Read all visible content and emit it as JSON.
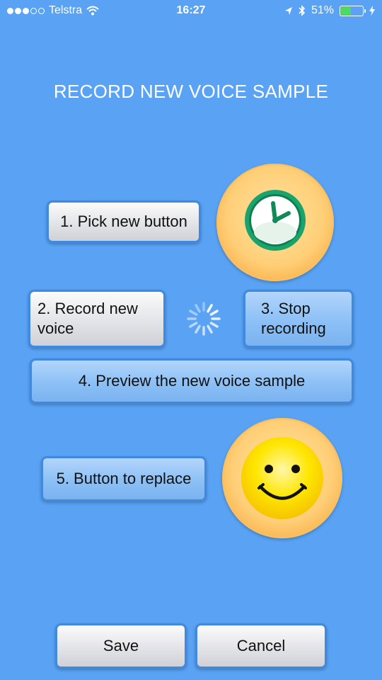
{
  "status_bar": {
    "carrier": "Telstra",
    "time": "16:27",
    "battery_percent": "51%",
    "battery_level": 0.51,
    "signal_bars_filled": 3,
    "signal_bars_total": 5,
    "icons": [
      "wifi-icon",
      "location-arrow-icon",
      "bluetooth-icon",
      "battery-icon",
      "charging-bolt-icon"
    ]
  },
  "page": {
    "title": "RECORD NEW VOICE SAMPLE"
  },
  "steps": {
    "pick_label": "1. Pick new button",
    "record_label": "2. Record new voice",
    "stop_label": "3. Stop recording",
    "preview_label": "4. Preview the new voice sample",
    "replace_label": "5. Button to replace"
  },
  "images": {
    "new_button_icon": "clock-icon",
    "replace_button_icon": "smiley-face-icon",
    "activity": "spinner-icon"
  },
  "footer": {
    "save_label": "Save",
    "cancel_label": "Cancel"
  },
  "colors": {
    "background": "#5aa3f4",
    "accent_green": "#1da06b",
    "coin_gold": "#ffcf78",
    "smiley_yellow": "#ffe100",
    "battery_green": "#4cd964"
  }
}
